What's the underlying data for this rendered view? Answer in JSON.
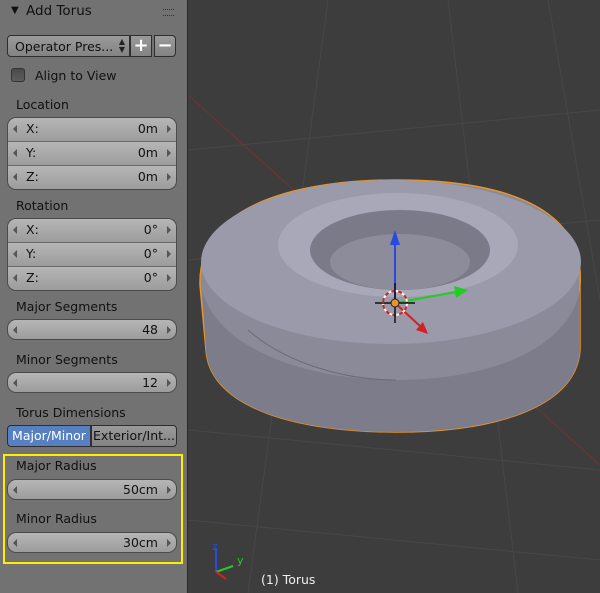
{
  "panel": {
    "title": "Add Torus",
    "preset_label": "Operator Pres...",
    "preset_add": "+",
    "preset_remove": "−",
    "align_to_view": "Align to View",
    "location": {
      "label": "Location",
      "x_key": "X:",
      "x_val": "0m",
      "y_key": "Y:",
      "y_val": "0m",
      "z_key": "Z:",
      "z_val": "0m"
    },
    "rotation": {
      "label": "Rotation",
      "x_key": "X:",
      "x_val": "0°",
      "y_key": "Y:",
      "y_val": "0°",
      "z_key": "Z:",
      "z_val": "0°"
    },
    "major_segments": {
      "label": "Major Segments",
      "value": "48"
    },
    "minor_segments": {
      "label": "Minor Segments",
      "value": "12"
    },
    "torus_dimensions": {
      "label": "Torus Dimensions",
      "mode_a": "Major/Minor",
      "mode_b": "Exterior/Int...",
      "selected": "Major/Minor"
    },
    "major_radius": {
      "label": "Major Radius",
      "value": "50cm"
    },
    "minor_radius": {
      "label": "Minor Radius",
      "value": "30cm"
    }
  },
  "viewport": {
    "object_label": "(1) Torus",
    "axis_z": "z",
    "axis_y": "y"
  },
  "colors": {
    "highlight": "#ffee00",
    "selected_button": "#5680c2",
    "selection_outline": "#e8942a",
    "axis_x": "#d42020",
    "axis_y": "#22cc22",
    "axis_z": "#2a4adf"
  }
}
